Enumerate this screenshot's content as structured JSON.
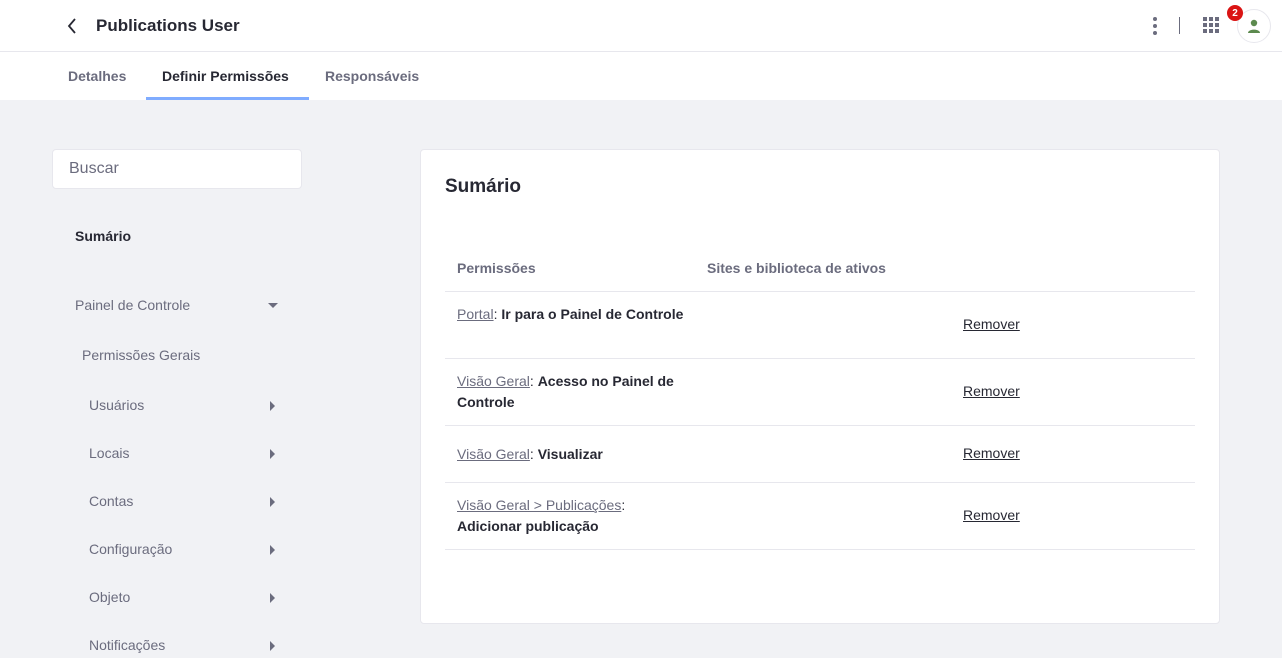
{
  "header": {
    "title": "Publications User",
    "notification_count": "2",
    "back_icon": "chevron-left-icon",
    "menu_icon": "ellipsis-v-icon",
    "apps_icon": "grid-icon",
    "avatar_icon": "user-icon"
  },
  "tabs": [
    {
      "label": "Detalhes",
      "active": false
    },
    {
      "label": "Definir Permissões",
      "active": true
    },
    {
      "label": "Responsáveis",
      "active": false
    }
  ],
  "sidebar": {
    "search_placeholder": "Buscar",
    "summary": "Sumário",
    "control_panel": "Painel de Controle",
    "general_permissions": "Permissões Gerais",
    "items": [
      {
        "label": "Usuários"
      },
      {
        "label": "Locais"
      },
      {
        "label": "Contas"
      },
      {
        "label": "Configuração"
      },
      {
        "label": "Objeto"
      },
      {
        "label": "Notificações"
      }
    ]
  },
  "main": {
    "title": "Sumário",
    "columns": {
      "permissions": "Permissões",
      "sites": "Sites e biblioteca de ativos"
    },
    "rows": [
      {
        "resource": "Portal",
        "action": "Ir para o Painel de Controle",
        "remove": "Remover"
      },
      {
        "resource": "Visão Geral",
        "action": "Acesso no Painel de Controle",
        "remove": "Remover"
      },
      {
        "resource": "Visão Geral",
        "action": "Visualizar",
        "remove": "Remover"
      },
      {
        "resource": "Visão Geral > Publicações",
        "action": "Adicionar publicação",
        "remove": "Remover"
      }
    ]
  },
  "colors": {
    "accent": "#80acff",
    "badge": "#da1414",
    "background": "#f1f2f5"
  }
}
